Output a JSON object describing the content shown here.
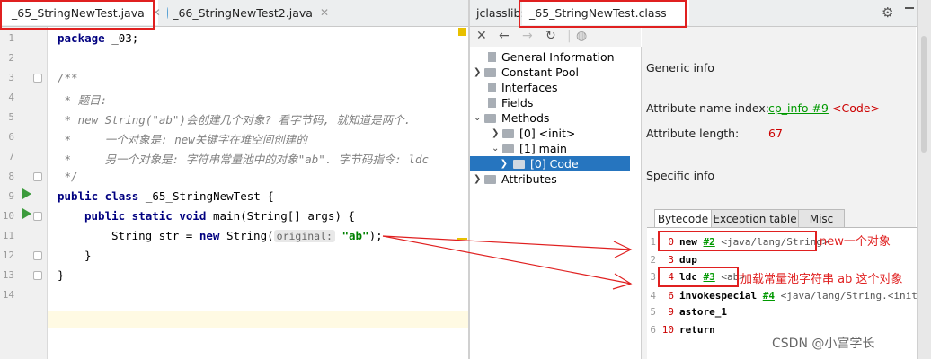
{
  "editor": {
    "tabs": [
      {
        "label": "_65_StringNewTest.java",
        "active": true
      },
      {
        "label": "_66_StringNewTest2.java",
        "active": false
      }
    ],
    "line_numbers": [
      "1",
      "2",
      "3",
      "4",
      "5",
      "6",
      "7",
      "8",
      "9",
      "10",
      "11",
      "12",
      "13",
      "14"
    ],
    "code": {
      "l1_kw": "package",
      "l1_rest": " _03;",
      "l3": "/**",
      "l4": " * 题目:",
      "l5": " * new String(\"ab\")会创建几个对象? 看字节码, 就知道是两个.",
      "l6": " *     一个对象是: new关键字在堆空间创建的",
      "l7": " *     另一个对象是: 字符串常量池中的对象\"ab\". 字节码指令: ldc",
      "l8": " */",
      "l9_kw": "public class",
      "l9_rest": " _65_StringNewTest {",
      "l10_kw": "public static void",
      "l10_rest": " main(String[] args) {",
      "l11_pre": "String str = ",
      "l11_kw": "new",
      "l11_mid": " String(",
      "l11_hint": "original:",
      "l11_str": "\"ab\"",
      "l11_end": ");",
      "l12": "}",
      "l13": "}"
    }
  },
  "jclasslib": {
    "tab_prefix": "jclasslib:",
    "tab_label": "_65_StringNewTest.class",
    "tree": {
      "general": "General Information",
      "constant_pool": "Constant Pool",
      "interfaces": "Interfaces",
      "fields": "Fields",
      "methods": "Methods",
      "m_init": "[0] <init>",
      "m_main": "[1] main",
      "m_code": "[0] Code",
      "attributes": "Attributes"
    },
    "info": {
      "generic_title": "Generic info",
      "attr_name_index_label": "Attribute name index:",
      "attr_name_index_link": "cp_info #9",
      "attr_name_index_value": "<Code>",
      "attr_length_label": "Attribute length:",
      "attr_length_value": "67",
      "specific_title": "Specific info"
    },
    "bytecode_tabs": [
      "Bytecode",
      "Exception table",
      "Misc"
    ],
    "bytecode": [
      {
        "n": "1",
        "offset": "0",
        "op": "new",
        "ref": "#2",
        "comment": "<java/lang/String>"
      },
      {
        "n": "2",
        "offset": "3",
        "op": "dup",
        "ref": "",
        "comment": ""
      },
      {
        "n": "3",
        "offset": "4",
        "op": "ldc",
        "ref": "#3",
        "comment": "<ab>"
      },
      {
        "n": "4",
        "offset": "6",
        "op": "invokespecial",
        "ref": "#4",
        "comment": "<java/lang/String.<init>>"
      },
      {
        "n": "5",
        "offset": "9",
        "op": "astore_1",
        "ref": "",
        "comment": ""
      },
      {
        "n": "6",
        "offset": "10",
        "op": "return",
        "ref": "",
        "comment": ""
      }
    ]
  },
  "annotations": {
    "new_note": "new一个对象",
    "ldc_note": "加载常量池字符串 ab 这个对象"
  },
  "watermark": "CSDN @小宫学长",
  "colors": {
    "annotation_red": "#e02020",
    "selection_blue": "#2675bf",
    "link_green": "#009900"
  }
}
